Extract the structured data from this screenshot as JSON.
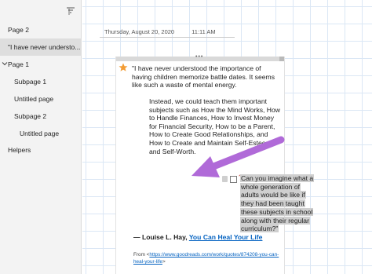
{
  "sidebar": {
    "items": [
      {
        "label": "Page 2"
      },
      {
        "label": "\"I have never understo..."
      },
      {
        "label": "Page 1"
      },
      {
        "label": "Subpage 1"
      },
      {
        "label": "Untitled page"
      },
      {
        "label": "Subpage 2"
      },
      {
        "label": "Untitled page"
      },
      {
        "label": "Helpers"
      }
    ]
  },
  "page": {
    "date": "Thursday, August 20, 2020",
    "time": "11:11 AM"
  },
  "note": {
    "paragraph1": "\"I have never understood the importance of having children memorize battle dates. It seems like such a waste of mental energy.",
    "paragraph2": "Instead, we could teach them important subjects such as How the Mind Works, How to Handle Finances, How to Invest Money for Financial Security, How to be a Parent, How to Create Good Relationships, and How to Create and Maintain Self-Esteem and Self-Worth.",
    "question_mark": "?",
    "highlighted": "Can you imagine what a whole generation of adults would be like if they had been taught these subjects in school along with their regular curriculum?\"",
    "author_prefix": "— Louise L. Hay,",
    "book_title": "You Can Heal Your Life",
    "source_prefix": "From <",
    "source_url": "https://www.goodreads.com/work/quotes/874208-you-can-heal-your-life",
    "source_suffix": ">"
  },
  "colors": {
    "star": "#f39c34",
    "arrow": "#b06ad8",
    "link": "#0563c1",
    "highlight": "#cfcfcf"
  }
}
